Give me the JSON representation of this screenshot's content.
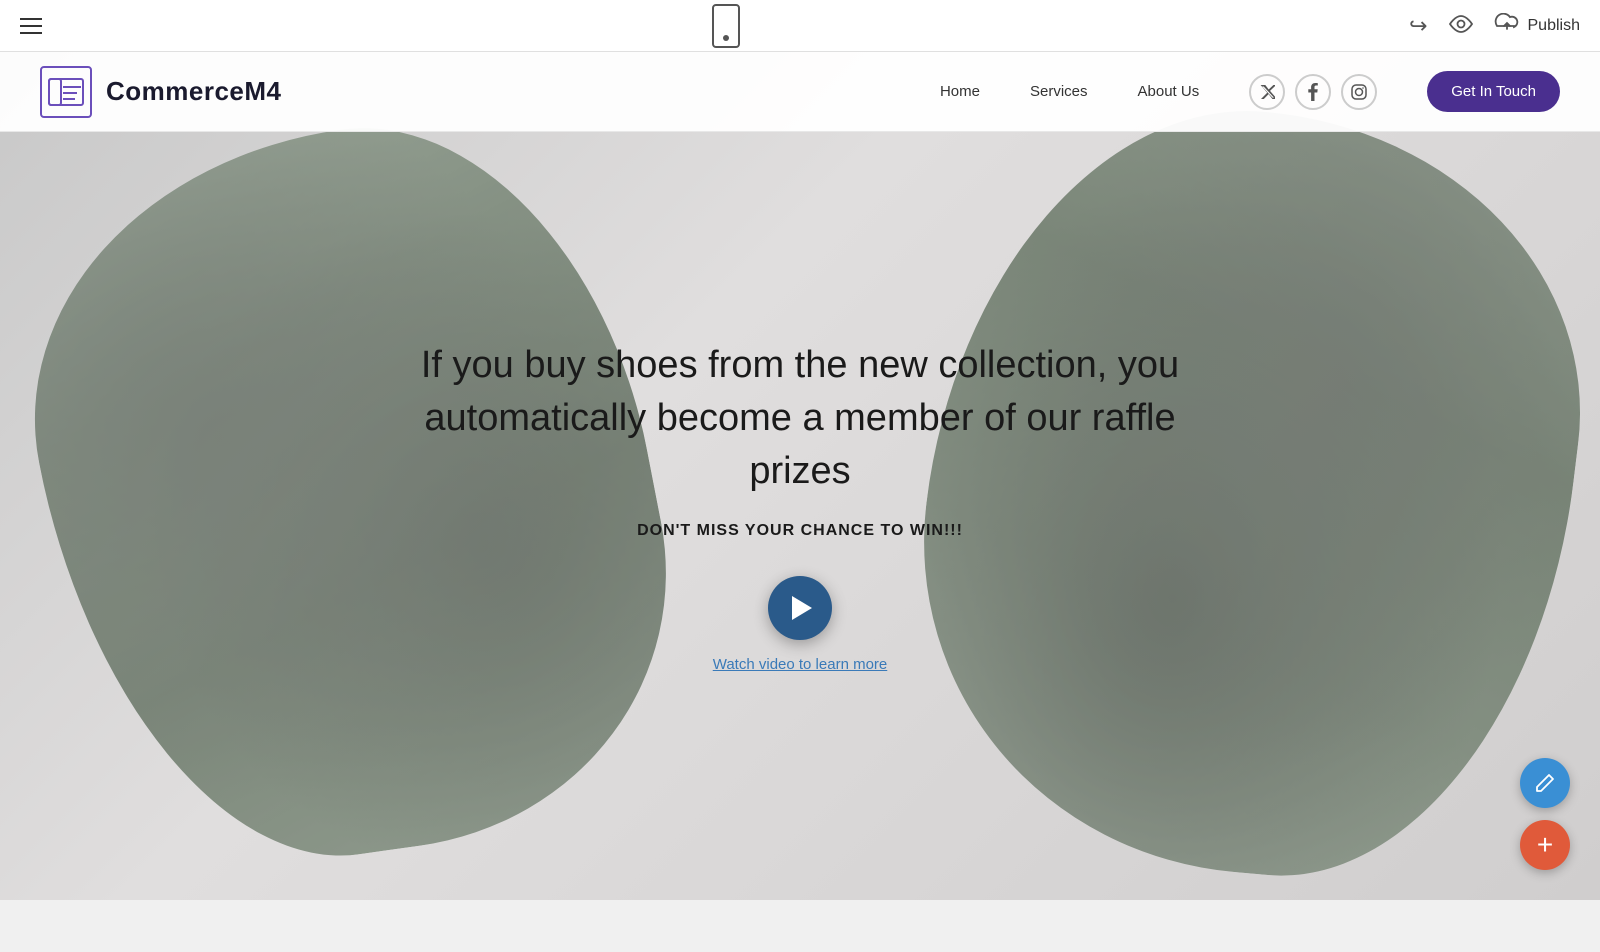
{
  "toolbar": {
    "publish_label": "Publish",
    "hamburger_label": "Menu"
  },
  "site": {
    "title": "CommerceM4",
    "nav": {
      "home": "Home",
      "services": "Services",
      "about_us": "About Us",
      "cta_button": "Get In Touch"
    },
    "hero": {
      "headline": "If you buy shoes from the new collection, you automatically become a member of our raffle prizes",
      "subheadline": "DON'T MISS YOUR CHANCE TO WIN!!!",
      "watch_video_label": "Watch video to learn more"
    }
  },
  "social": {
    "twitter": "𝕏",
    "facebook": "f",
    "instagram": "◎"
  },
  "fab": {
    "edit_icon": "✏",
    "add_icon": "+"
  }
}
